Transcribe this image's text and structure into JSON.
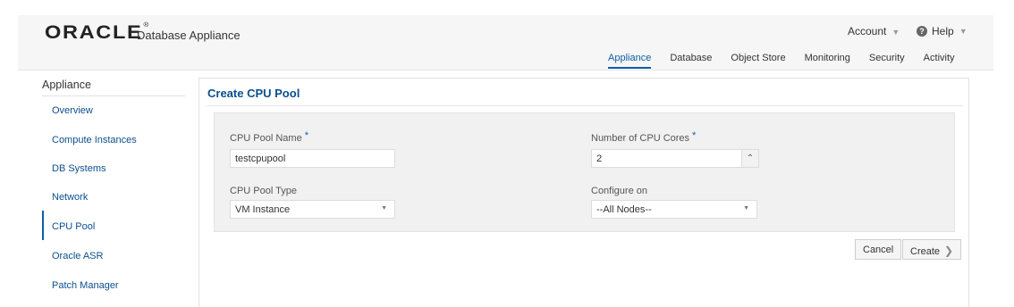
{
  "header": {
    "logo_text": "ORACLE",
    "logo_mark": "®",
    "product": "Database Appliance",
    "account": "Account",
    "help": "Help",
    "help_icon_glyph": "?",
    "caret_glyph": "▼"
  },
  "tabs": [
    {
      "label": "Appliance",
      "active": true
    },
    {
      "label": "Database",
      "active": false
    },
    {
      "label": "Object Store",
      "active": false
    },
    {
      "label": "Monitoring",
      "active": false
    },
    {
      "label": "Security",
      "active": false
    },
    {
      "label": "Activity",
      "active": false
    }
  ],
  "sidebar": {
    "title": "Appliance",
    "items": [
      {
        "label": "Overview"
      },
      {
        "label": "Compute Instances"
      },
      {
        "label": "DB Systems"
      },
      {
        "label": "Network"
      },
      {
        "label": "CPU Pool",
        "active": true
      },
      {
        "label": "Oracle ASR"
      },
      {
        "label": "Patch Manager"
      }
    ]
  },
  "form": {
    "title": "Create CPU Pool",
    "required_mark": "*",
    "pool_name_label": "CPU Pool Name",
    "pool_name_value": "testcpupool",
    "cores_label": "Number of CPU Cores",
    "cores_value": "2",
    "stepper_down": "⌄",
    "stepper_up": "⌃",
    "pool_type_label": "CPU Pool Type",
    "pool_type_value": "VM Instance",
    "configure_label": "Configure on",
    "configure_value": "--All Nodes--",
    "select_caret": "▼"
  },
  "buttons": {
    "cancel": "Cancel",
    "create": "Create",
    "create_chevron": "❯"
  },
  "colors": {
    "accent": "#0b5ea8",
    "link": "#0b4f8f",
    "panel_bg": "#f1f1f1"
  }
}
